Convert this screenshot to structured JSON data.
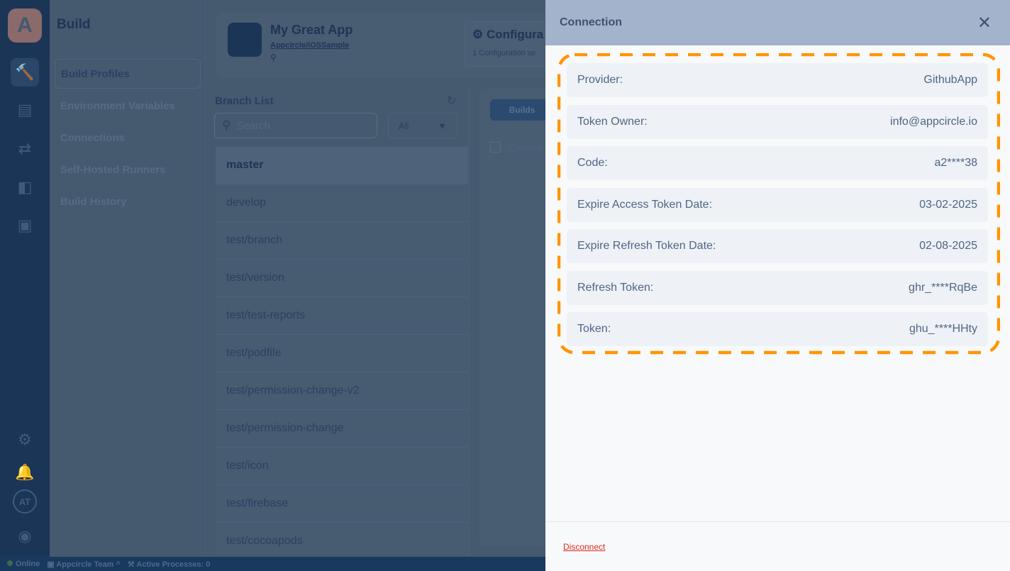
{
  "nav": {
    "items": [
      "build",
      "signing-identities",
      "distribution",
      "store-submission",
      "enterprise-store"
    ],
    "bottom": [
      "integrations",
      "notifications",
      "AT",
      "profile"
    ]
  },
  "submenu": {
    "title": "Build",
    "items": [
      "Build Profiles",
      "Environment Variables",
      "Connections",
      "Self-Hosted Runners",
      "Build History"
    ],
    "active": "Build Profiles"
  },
  "app": {
    "name": "My Great App",
    "repo": "Appcircle/iOSSample"
  },
  "config": {
    "title": "Configura",
    "subtitle": "1 Configuration se"
  },
  "branch_list": {
    "title": "Branch List",
    "search_placeholder": "Search",
    "filter": "All",
    "branches": [
      "master",
      "develop",
      "test/branch",
      "test/version",
      "test/test-reports",
      "test/podfile",
      "test/permission-change-v2",
      "test/permission-change",
      "test/icon",
      "test/firebase",
      "test/cocoapods"
    ]
  },
  "builds": {
    "tab": "Builds",
    "commit_header": "Commit"
  },
  "status_bar": {
    "online": "Online",
    "team": "Appcircle Team",
    "processes": "Active Processes: 0"
  },
  "panel": {
    "title": "Connection",
    "highlight_color": "#ff9500",
    "rows": [
      {
        "label": "Provider:",
        "value": "GithubApp"
      },
      {
        "label": "Token Owner:",
        "value": "info@appcircle.io"
      },
      {
        "label": "Code:",
        "value": "a2****38"
      },
      {
        "label": "Expire Access Token Date:",
        "value": "03-02-2025"
      },
      {
        "label": "Expire Refresh Token Date:",
        "value": "02-08-2025"
      },
      {
        "label": "Refresh Token:",
        "value": "ghr_****RqBe"
      },
      {
        "label": "Token:",
        "value": "ghu_****HHty"
      }
    ],
    "disconnect": "Disconnect"
  }
}
